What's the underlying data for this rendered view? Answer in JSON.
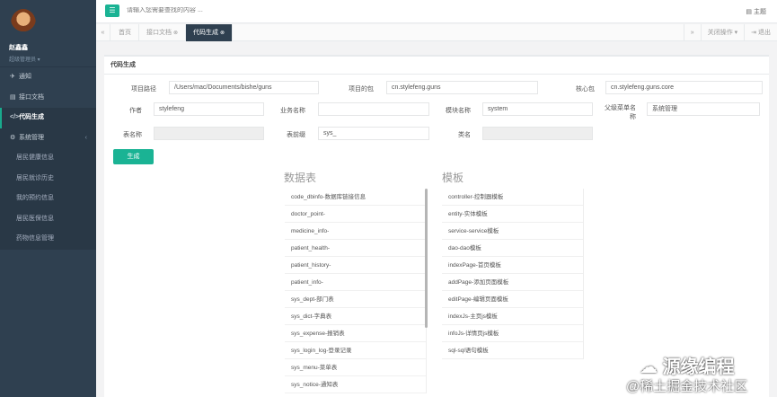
{
  "user": {
    "name": "赵鑫鑫",
    "role": "超级管理员"
  },
  "sidebar": {
    "items": [
      {
        "icon": "✈",
        "label": "通知"
      },
      {
        "icon": "▤",
        "label": "接口文档"
      },
      {
        "icon": "</>",
        "label": "代码生成"
      },
      {
        "icon": "⚙",
        "label": "系统管理"
      }
    ],
    "subitems": [
      "居民健康信息",
      "居民就诊历史",
      "我的预约信息",
      "居民医保信息",
      "药物信息管理"
    ]
  },
  "topbar": {
    "toggle": "☰",
    "search_placeholder": "请输入您需要查找的内容 ...",
    "theme": "主题"
  },
  "tabbar": {
    "tabs": [
      "首页",
      "接口文档",
      "代码生成"
    ],
    "close_ops": "关闭操作",
    "exit": "退出"
  },
  "panel": {
    "title": "代码生成"
  },
  "form": {
    "project_path_label": "项目路径",
    "project_path_value": "/Users/mac/Documents/bishe/guns",
    "project_pkg_label": "项目的包",
    "project_pkg_value": "cn.stylefeng.guns",
    "core_pkg_label": "核心包",
    "core_pkg_value": "cn.stylefeng.guns.core",
    "author_label": "作者",
    "author_value": "stylefeng",
    "biz_name_label": "业务名称",
    "biz_name_value": "",
    "module_label": "模块名称",
    "module_value": "system",
    "parent_menu_label": "父级菜单名称",
    "parent_menu_value": "系统管理",
    "table_label": "表名称",
    "table_value": "",
    "prefix_label": "表前缀",
    "prefix_value": "sys_",
    "class_label": "类名",
    "class_value": "",
    "generate_button": "生成"
  },
  "tables": {
    "title": "数据表",
    "items": [
      "code_dbinfo-数据库链接信息",
      "doctor_point-",
      "medicine_info-",
      "patient_health-",
      "patient_history-",
      "patient_info-",
      "sys_dept-部门表",
      "sys_dict-字典表",
      "sys_expense-报销表",
      "sys_login_log-登录记录",
      "sys_menu-菜单表",
      "sys_notice-通知表"
    ]
  },
  "templates": {
    "title": "模板",
    "items": [
      "controller-控制器模板",
      "entity-实体模板",
      "service-service模板",
      "dao-dao模板",
      "indexPage-首页模板",
      "addPage-添加页面模板",
      "editPage-编辑页面模板",
      "indexJs-主页js模板",
      "infoJs-详情页js模板",
      "sql-sql语句模板"
    ]
  },
  "watermark": {
    "line1": "源缘编程",
    "line2": "@稀土掘金技术社区"
  }
}
